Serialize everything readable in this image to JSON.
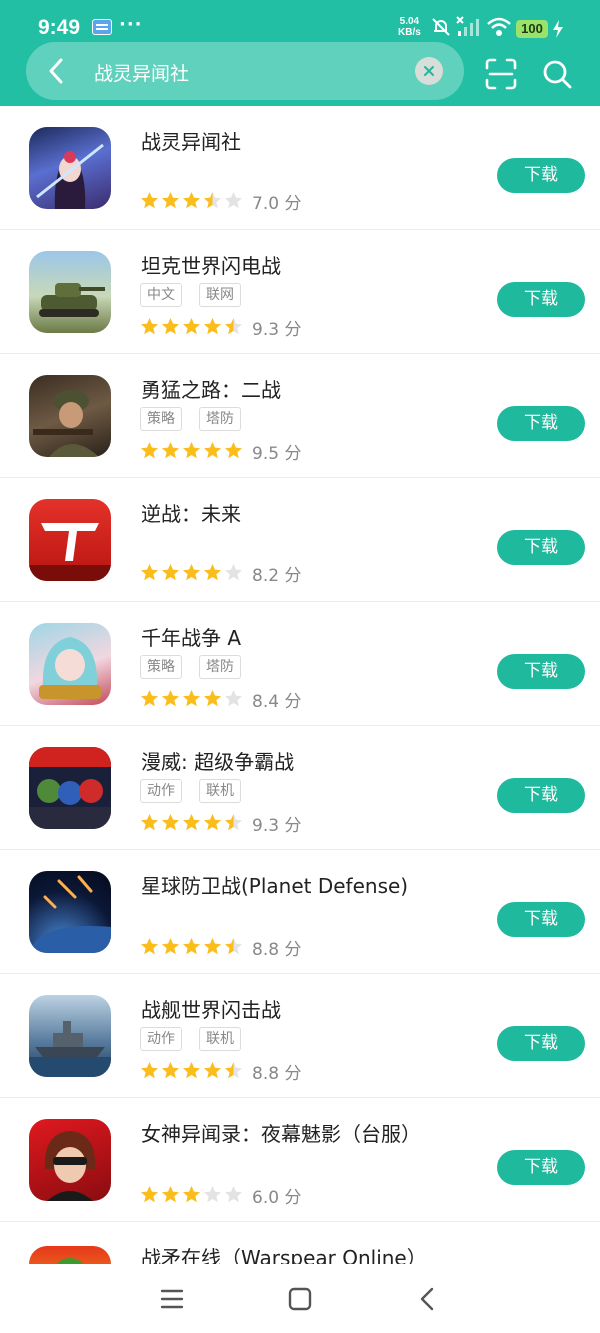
{
  "status_bar": {
    "time": "9:49",
    "dots": "···",
    "speed_value": "5.04",
    "speed_unit": "KB/s",
    "battery": "100",
    "icons": [
      "mail-icon",
      "mute-icon",
      "no-signal-icon",
      "wifi-icon",
      "charging-icon"
    ]
  },
  "search": {
    "query": "战灵异闻社"
  },
  "colors": {
    "header": "#22bfa4",
    "download_button": "#1fb99e",
    "star_filled": "#fbbd1c",
    "star_empty": "#e3e3e3"
  },
  "apps": [
    {
      "name": "战灵异闻社",
      "tags": [],
      "rating": 3.5,
      "score": "7.0 分",
      "button": "下载"
    },
    {
      "name": "坦克世界闪电战",
      "tags": [
        "中文",
        "联网"
      ],
      "rating": 4.5,
      "score": "9.3 分",
      "button": "下载"
    },
    {
      "name": "勇猛之路：二战",
      "tags": [
        "策略",
        "塔防"
      ],
      "rating": 5,
      "score": "9.5 分",
      "button": "下载"
    },
    {
      "name": "逆战：未来",
      "tags": [],
      "rating": 4,
      "score": "8.2 分",
      "button": "下载"
    },
    {
      "name": "千年战争 A",
      "tags": [
        "策略",
        "塔防"
      ],
      "rating": 4,
      "score": "8.4 分",
      "button": "下载"
    },
    {
      "name": "漫威: 超级争霸战",
      "tags": [
        "动作",
        "联机"
      ],
      "rating": 4.5,
      "score": "9.3 分",
      "button": "下载"
    },
    {
      "name": "星球防卫战(Planet Defense)",
      "tags": [],
      "rating": 4.5,
      "score": "8.8 分",
      "button": "下载"
    },
    {
      "name": "战舰世界闪击战",
      "tags": [
        "动作",
        "联机"
      ],
      "rating": 4.5,
      "score": "8.8 分",
      "button": "下载"
    },
    {
      "name": "女神异闻录：夜幕魅影（台服）",
      "tags": [],
      "rating": 3,
      "score": "6.0 分",
      "button": "下载"
    },
    {
      "name": "战矛在线（Warspear Online）",
      "tags": [],
      "rating": 0,
      "score": "",
      "button": ""
    }
  ],
  "nav": [
    "menu-icon",
    "home-icon",
    "back-icon"
  ]
}
